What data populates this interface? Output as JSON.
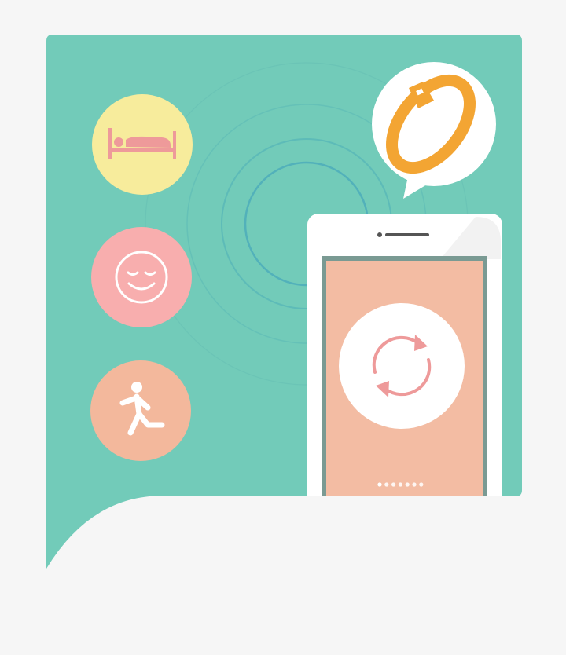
{
  "colors": {
    "page_background": "#f6f6f6",
    "panel_teal": "#72cbb9",
    "sleep_circle": "#f7ec9c",
    "mood_circle": "#f8aeae",
    "activity_circle": "#f3b89c",
    "phone_screen": "#f3bca3",
    "band_orange": "#f3a533",
    "icon_pink": "#ee9a9a",
    "white": "#ffffff"
  },
  "icons": {
    "sleep": "bed-icon",
    "mood": "smiley-face-icon",
    "activity": "running-person-icon",
    "wearable": "fitness-band-icon",
    "sync": "sync-arrows-icon"
  },
  "phone": {
    "page_count": 7,
    "active_page": 1
  }
}
